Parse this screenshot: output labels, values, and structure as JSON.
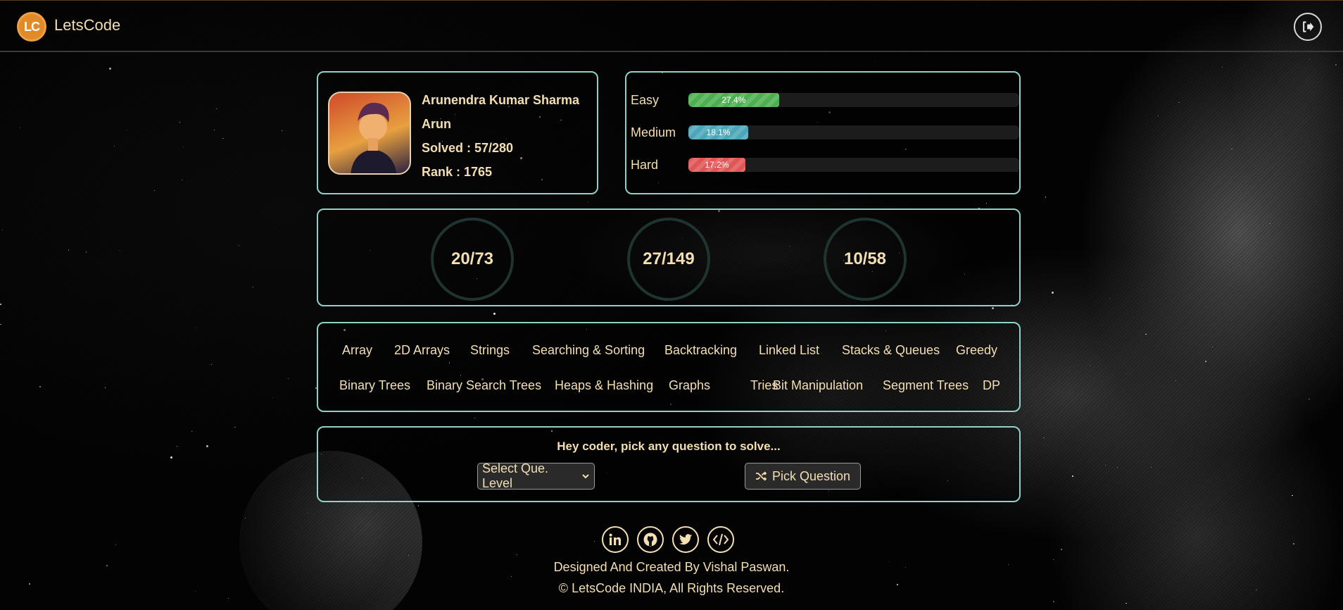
{
  "header": {
    "logo_text": "LC",
    "brand": "LetsCode",
    "logout_icon": "logout-icon"
  },
  "profile": {
    "name": "Arunendra Kumar Sharma",
    "username": "Arun",
    "solved": "Solved : 57/280",
    "rank": "Rank : 1765"
  },
  "levels": [
    {
      "label": "Easy",
      "percent_text": "27.4%",
      "fraction": 0.274,
      "color": "#4caf50"
    },
    {
      "label": "Medium",
      "percent_text": "18.1%",
      "fraction": 0.181,
      "color": "#4aa6b8"
    },
    {
      "label": "Hard",
      "percent_text": "17.2%",
      "fraction": 0.172,
      "color": "#e05555"
    }
  ],
  "circles": [
    "20/73",
    "27/149",
    "10/58"
  ],
  "topics": {
    "row1": [
      "Array",
      "2D Arrays",
      "Strings",
      "Searching & Sorting",
      "Backtracking",
      "Linked List",
      "Stacks & Queues",
      "Greedy"
    ],
    "row2": [
      "Binary Trees",
      "Binary Search Trees",
      "Heaps & Hashing",
      "Graphs",
      "Tries",
      "Bit Manipulation",
      "Segment Trees",
      "DP"
    ]
  },
  "picker": {
    "title": "Hey coder, pick any question to solve...",
    "select_value": "Select Que. Level",
    "button_label": "Pick Question",
    "button_icon": "shuffle-icon"
  },
  "footer": {
    "social": [
      "linkedin-icon",
      "github-icon",
      "twitter-icon",
      "code-icon"
    ],
    "credit": "Designed And Created By Vishal Paswan.",
    "copyright": "LetsCode INDIA, All Rights Reserved."
  },
  "colors": {
    "accent_text": "#f3dfb3",
    "card_border": "#8fd3c8",
    "logo_orange": "#e08a2a"
  }
}
